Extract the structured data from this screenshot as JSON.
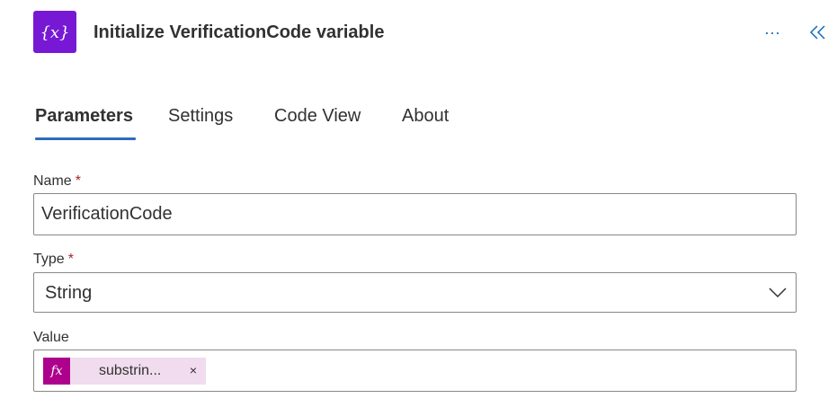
{
  "header": {
    "title": "Initialize VerificationCode variable",
    "icon": "variable-icon",
    "icon_text": "{x}",
    "icon_color": "#7719d4",
    "more_label": "···",
    "collapse_icon": "double-chevron-left-icon"
  },
  "tabs": [
    {
      "label": "Parameters",
      "active": true
    },
    {
      "label": "Settings",
      "active": false
    },
    {
      "label": "Code View",
      "active": false
    },
    {
      "label": "About",
      "active": false
    }
  ],
  "fields": {
    "name": {
      "label": "Name",
      "required_mark": "*",
      "value": "VerificationCode"
    },
    "type": {
      "label": "Type",
      "required_mark": "*",
      "selected": "String"
    },
    "value": {
      "label": "Value",
      "token": {
        "icon": "fx-icon",
        "icon_text": "fx",
        "text": "substrin...",
        "remove": "×",
        "color": "#ad008c"
      }
    }
  },
  "colors": {
    "accent": "#2b6dbc",
    "required": "#a4262c",
    "link": "#0f6cbd"
  }
}
